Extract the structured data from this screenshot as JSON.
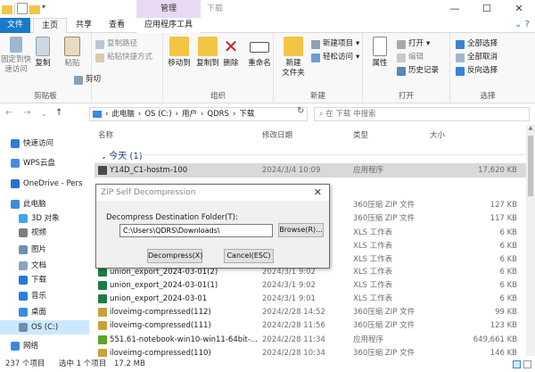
{
  "titlebar": {
    "context_tab": "管理",
    "title": "下载",
    "min": "—",
    "max": "☐",
    "close": "✕"
  },
  "tabs": {
    "file": "文件",
    "home": "主页",
    "share": "共享",
    "view": "查看",
    "app_tools": "应用程序工具"
  },
  "ribbon": {
    "clipboard": {
      "label": "剪贴板",
      "pin": "固定到快\n速访问",
      "copy": "复制",
      "paste": "粘贴",
      "copy_path": "复制路径",
      "paste_shortcut": "粘贴快捷方式",
      "cut": "剪切"
    },
    "organize": {
      "label": "组织",
      "move_to": "移动到",
      "copy_to": "复制到",
      "delete": "删除",
      "rename": "重命名"
    },
    "new": {
      "label": "新建",
      "new_folder": "新建\n文件夹",
      "new_item": "新建项目",
      "easy_access": "轻松访问"
    },
    "open": {
      "label": "打开",
      "properties": "属性",
      "open": "打开",
      "edit": "编辑",
      "history": "历史记录"
    },
    "select": {
      "label": "选择",
      "select_all": "全部选择",
      "select_none": "全部取消",
      "invert": "反向选择"
    }
  },
  "address": {
    "path_pc": "此电脑",
    "path_c": "OS (C:)",
    "path_users": "用户",
    "path_user": "QDRS",
    "path_dl": "下载",
    "search_placeholder": "在 下载 中搜索"
  },
  "nav": [
    {
      "label": "快速访问",
      "color": "#2b7fd8"
    },
    {
      "label": "WPS云盘",
      "color": "#4a8be0"
    },
    {
      "label": "OneDrive - Pers",
      "color": "#2a72d1"
    },
    {
      "label": "此电脑",
      "color": "#3a8be0"
    },
    {
      "label": "3D 对象",
      "color": "#43a5e6"
    },
    {
      "label": "视频",
      "color": "#7d7d7d"
    },
    {
      "label": "图片",
      "color": "#6d8db5"
    },
    {
      "label": "文档",
      "color": "#8ca3c2"
    },
    {
      "label": "下载",
      "color": "#2777d6"
    },
    {
      "label": "音乐",
      "color": "#2b7fd8"
    },
    {
      "label": "桌面",
      "color": "#3a8be0"
    },
    {
      "label": "OS (C:)",
      "color": "#6f8fb0"
    },
    {
      "label": "网络",
      "color": "#3a8be0"
    }
  ],
  "columns": {
    "name": "名称",
    "date": "修改日期",
    "type": "类型",
    "size": "大小"
  },
  "group_today": "今天 (1)",
  "files": [
    {
      "name": "Y14D_C1-hostm-100",
      "date": "2024/3/4 10:09",
      "type": "应用程序",
      "size": "17,620 KB",
      "color": "#4a4a4a"
    },
    {
      "name": "",
      "date": "",
      "type": "360压缩 ZIP 文件",
      "size": "127 KB",
      "color": "#c9a23a"
    },
    {
      "name": "",
      "date": "",
      "type": "360压缩 ZIP 文件",
      "size": "117 KB",
      "color": "#c9a23a"
    },
    {
      "name": "",
      "date": "",
      "type": "XLS 工作表",
      "size": "6 KB",
      "color": "#1e7b45"
    },
    {
      "name": "",
      "date": "",
      "type": "XLS 工作表",
      "size": "6 KB",
      "color": "#1e7b45"
    },
    {
      "name": "",
      "date": "",
      "type": "XLS 工作表",
      "size": "6 KB",
      "color": "#1e7b45"
    },
    {
      "name": "union_export_2024-03-01(2)",
      "date": "2024/3/1 9:02",
      "type": "XLS 工作表",
      "size": "6 KB",
      "color": "#1e7b45"
    },
    {
      "name": "union_export_2024-03-01(1)",
      "date": "2024/3/1 9:02",
      "type": "XLS 工作表",
      "size": "6 KB",
      "color": "#1e7b45"
    },
    {
      "name": "union_export_2024-03-01",
      "date": "2024/3/1 9:01",
      "type": "XLS 工作表",
      "size": "6 KB",
      "color": "#1e7b45"
    },
    {
      "name": "iloveimg-compressed(112)",
      "date": "2024/2/28 14:52",
      "type": "360压缩 ZIP 文件",
      "size": "99 KB",
      "color": "#c9a23a"
    },
    {
      "name": "iloveimg-compressed(111)",
      "date": "2024/2/28 11:56",
      "type": "360压缩 ZIP 文件",
      "size": "123 KB",
      "color": "#c9a23a"
    },
    {
      "name": "551.61-notebook-win10-win11-64bit-...",
      "date": "2024/2/28 11:34",
      "type": "应用程序",
      "size": "649,661 KB",
      "color": "#5aa52a"
    },
    {
      "name": "iloveimg-compressed(110)",
      "date": "2024/2/28 10:34",
      "type": "360压缩 ZIP 文件",
      "size": "146 KB",
      "color": "#c9a23a"
    }
  ],
  "status": {
    "count": "237 个项目",
    "selected": "选中 1 个项目",
    "size": "17.2 MB"
  },
  "dialog": {
    "title": "ZIP Self Decompression",
    "close": "✕",
    "label": "Decompress Destination Folder(T):",
    "path": "C:\\Users\\QDRS\\Downloads\\",
    "browse": "Browse(R)...",
    "decompress": "Decompress(X)",
    "cancel": "Cancel(ESC)"
  }
}
